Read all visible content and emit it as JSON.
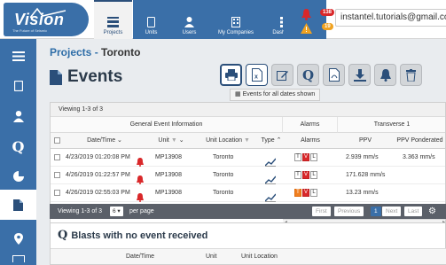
{
  "header": {
    "logo_text": "Vision",
    "logo_tagline": "The Future of Seismic",
    "nav": [
      {
        "label": "Projects"
      },
      {
        "label": "Units"
      },
      {
        "label": "Users"
      },
      {
        "label": "My Companies"
      },
      {
        "label": "Dashboard"
      }
    ],
    "alert_count": "138",
    "warning_count": "19",
    "user_email": "instantel.tutorials@gmail.com"
  },
  "breadcrumb": {
    "section": "Projects",
    "separator": " - ",
    "current": "Toronto"
  },
  "page_title": "Events",
  "tooltip": "Events for all dates shown",
  "grid": {
    "viewing": "Viewing 1-3 of 3",
    "groups": {
      "general": "General Event Information",
      "alarms": "Alarms",
      "transverse": "Transverse 1"
    },
    "columns": {
      "datetime": "Date/Time",
      "unit": "Unit",
      "location": "Unit Location",
      "type": "Type",
      "alarms": "Alarms",
      "ppv": "PPV",
      "ppv_pond": "PPV Ponderated"
    },
    "rows": [
      {
        "datetime": "4/23/2019 01:20:08 PM",
        "unit": "MP13908",
        "location": "Toronto",
        "alarms": [
          "T",
          "V",
          "L"
        ],
        "ppv": "2.939 mm/s",
        "ppv_pond": "3.363 mm/s"
      },
      {
        "datetime": "4/26/2019 01:22:57 PM",
        "unit": "MP13908",
        "location": "Toronto",
        "alarms": [
          "T",
          "V",
          "L"
        ],
        "ppv": "171.628 mm/s",
        "ppv_pond": ""
      },
      {
        "datetime": "4/26/2019 02:55:03 PM",
        "unit": "MP13908",
        "location": "Toronto",
        "alarms": [
          "T",
          "V",
          "L"
        ],
        "ppv": "13.23 mm/s",
        "ppv_pond": ""
      }
    ]
  },
  "pager": {
    "viewing": "Viewing 1-3 of 3",
    "per_page_value": "6",
    "per_page_label": "per page",
    "first": "First",
    "previous": "Previous",
    "current": "1",
    "next": "Next",
    "last": "Last"
  },
  "blasts": {
    "title": "Blasts with no event received",
    "columns": {
      "datetime": "Date/Time",
      "unit": "Unit",
      "location": "Unit Location"
    }
  }
}
